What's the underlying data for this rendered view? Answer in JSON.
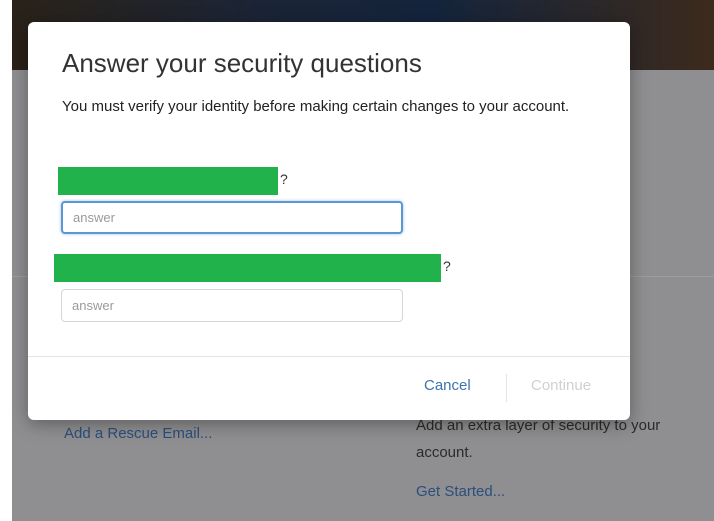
{
  "modal": {
    "title": "Answer your security questions",
    "description": "You must verify your identity before making certain changes to your account.",
    "questions": [
      {
        "question_suffix": "?",
        "answer_placeholder": "answer",
        "answer_value": ""
      },
      {
        "question_suffix": "?",
        "answer_placeholder": "answer",
        "answer_value": ""
      }
    ],
    "cancel_label": "Cancel",
    "continue_label": "Continue"
  },
  "background": {
    "rescue_email_link": "Add a Rescue Email...",
    "extra_security_lines": [
      "Add an extra layer of security to your",
      "account."
    ],
    "get_started_link": "Get Started..."
  },
  "colors": {
    "accent": "#3c73ad",
    "redaction": "#22b24c",
    "focus_ring": "#5d97d1"
  }
}
